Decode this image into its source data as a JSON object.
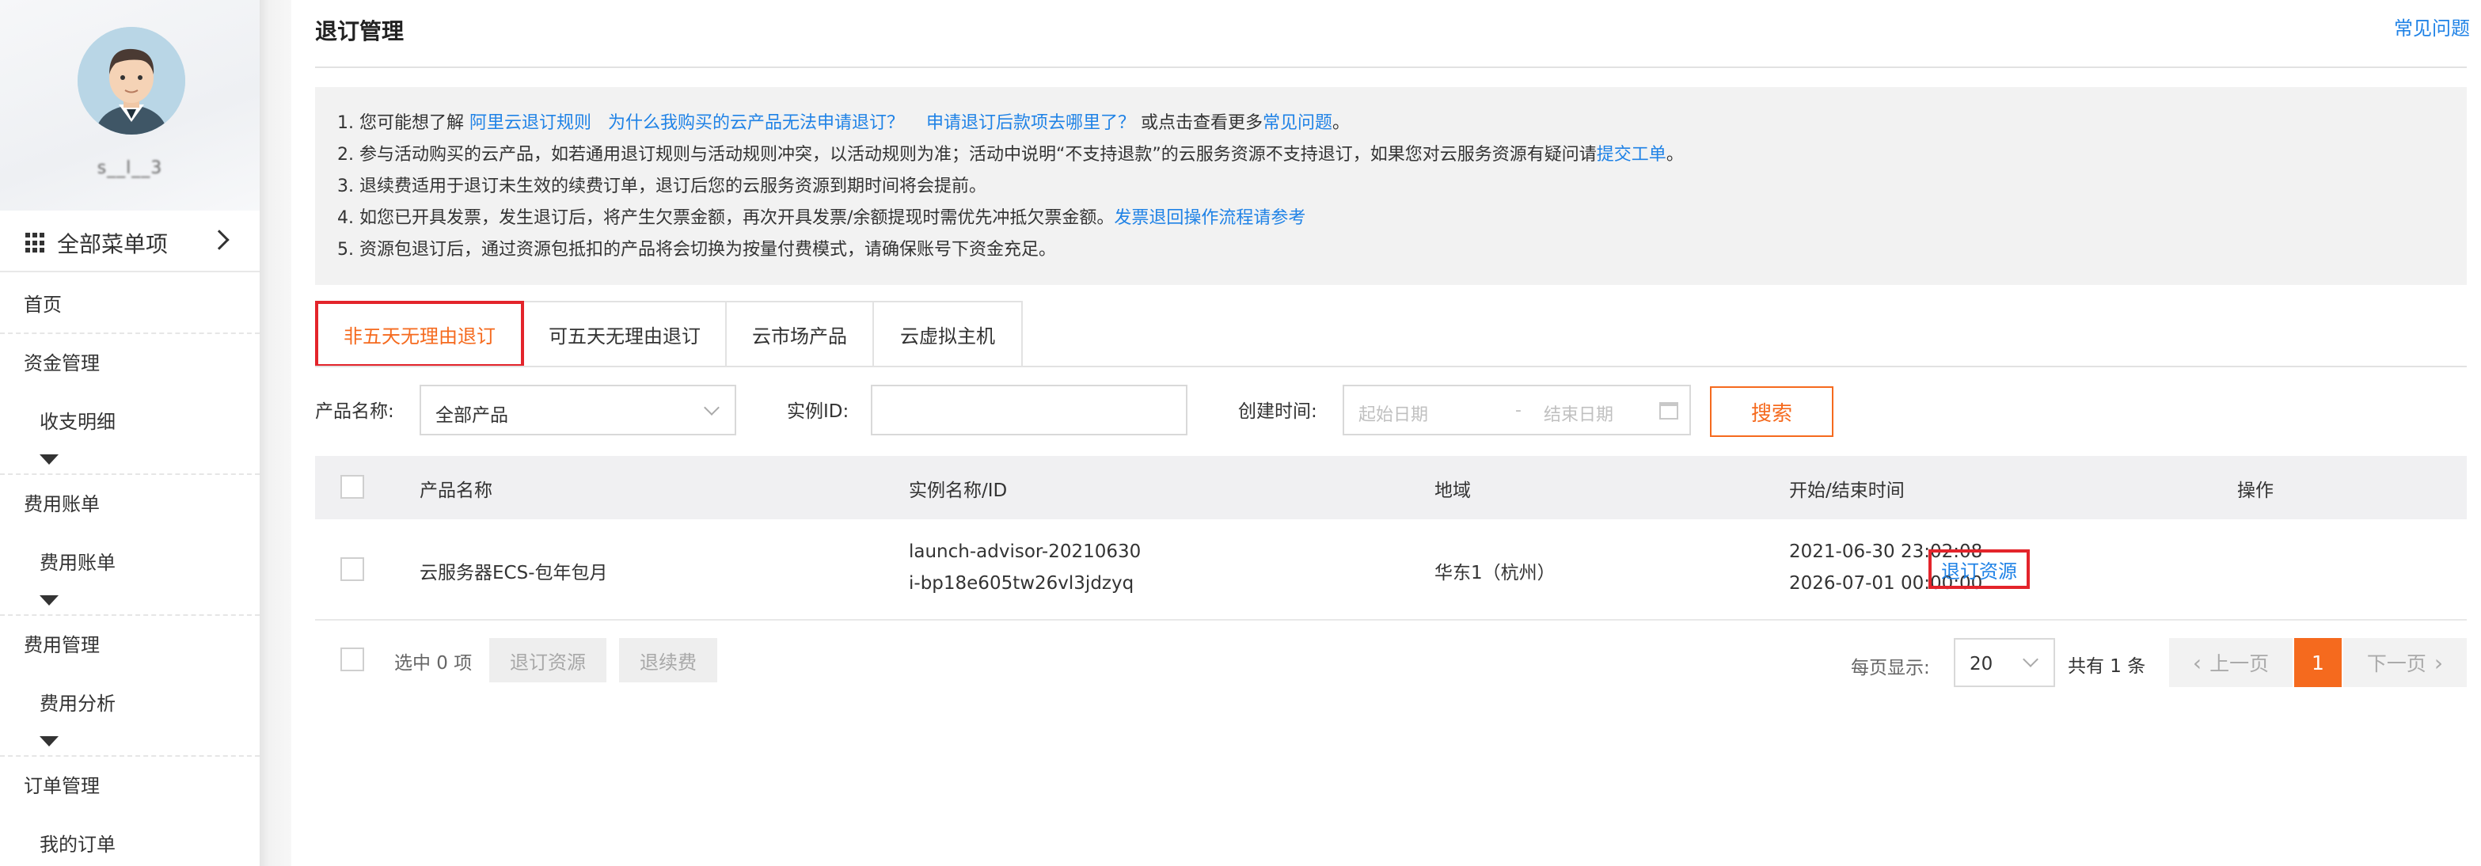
{
  "sidebar": {
    "username": "s__l__3",
    "all_menu_label": "全部菜单项",
    "items": [
      {
        "label": "首页"
      },
      {
        "label": "资金管理"
      },
      {
        "label": "收支明细"
      },
      {
        "label": "费用账单"
      },
      {
        "label": "费用账单"
      },
      {
        "label": "费用管理"
      },
      {
        "label": "费用分析"
      },
      {
        "label": "订单管理"
      },
      {
        "label": "我的订单"
      }
    ]
  },
  "header": {
    "title": "退订管理",
    "faq_link": "常见问题"
  },
  "notice": {
    "l1_prefix": "1. 您可能想了解 ",
    "l1_link1": "阿里云退订规则",
    "l1_link2": "为什么我购买的云产品无法申请退订？",
    "l1_link3": "申请退订后款项去哪里了？",
    "l1_mid": " 或点击查看更多",
    "l1_link4": "常见问题",
    "l1_end": "。",
    "l2_text": "2. 参与活动购买的云产品，如若通用退订规则与活动规则冲突，以活动规则为准；活动中说明“不支持退款”的云服务资源不支持退订，如果您对云服务资源有疑问请",
    "l2_link": "提交工单",
    "l2_end": "。",
    "l3_text": "3. 退续费适用于退订未生效的续费订单，退订后您的云服务资源到期时间将会提前。",
    "l4_text": "4. 如您已开具发票，发生退订后，将产生欠票金额，再次开具发票/余额提现时需优先冲抵欠票金额。",
    "l4_link": "发票退回操作流程请参考",
    "l5_text": "5. 资源包退订后，通过资源包抵扣的产品将会切换为按量付费模式，请确保账号下资金充足。"
  },
  "tabs": [
    {
      "label": "非五天无理由退订",
      "active": true
    },
    {
      "label": "可五天无理由退订",
      "active": false
    },
    {
      "label": "云市场产品",
      "active": false
    },
    {
      "label": "云虚拟主机",
      "active": false
    }
  ],
  "filters": {
    "product_label": "产品名称:",
    "product_value": "全部产品",
    "instance_label": "实例ID:",
    "instance_value": "",
    "time_label": "创建时间:",
    "start_placeholder": "起始日期",
    "date_sep": "-",
    "end_placeholder": "结束日期",
    "search_button": "搜索"
  },
  "table": {
    "headers": [
      "产品名称",
      "实例名称/ID",
      "地域",
      "开始/结束时间",
      "操作"
    ],
    "rows": [
      {
        "product": "云服务器ECS-包年包月",
        "instance_name": "launch-advisor-20210630",
        "instance_id": "i-bp18e605tw26vl3jdzyq",
        "region": "华东1（杭州）",
        "start_time": "2021-06-30 23:02:08",
        "end_time": "2026-07-01 00:00:00",
        "action": "退订资源"
      }
    ]
  },
  "footer": {
    "selected": "选中 0 项",
    "unsubscribe_button": "退订资源",
    "renew_refund_button": "退续费",
    "per_page_label": "每页显示:",
    "per_page_value": "20",
    "total": "共有 1 条",
    "prev": "上一页",
    "current_page": "1",
    "next": "下一页"
  },
  "colors": {
    "accent": "#f56a1e",
    "link": "#1f82e6",
    "highlight_box": "#e3242b"
  }
}
